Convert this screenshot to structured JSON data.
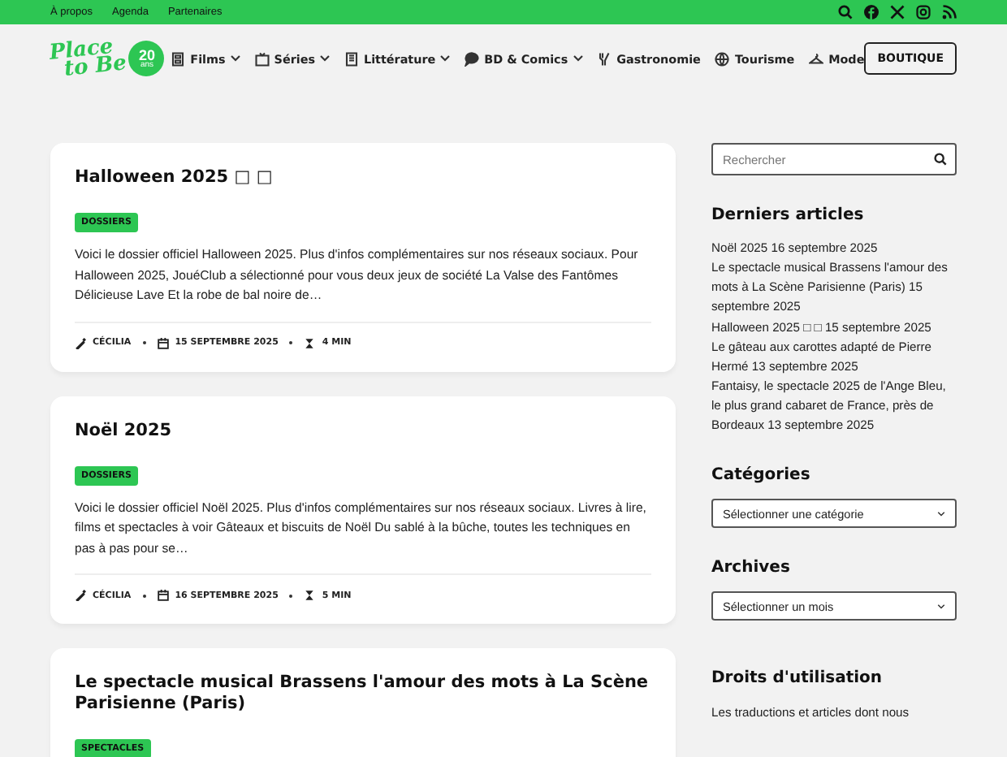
{
  "top_bar": {
    "links": [
      "À propos",
      "Agenda",
      "Partenaires"
    ]
  },
  "header": {
    "logo": {
      "line1": "Place",
      "line2": "to Be",
      "badge_number": "20",
      "badge_text": "ans"
    },
    "nav": [
      {
        "label": "Films",
        "kind": "film",
        "dropdown": true
      },
      {
        "label": "Séries",
        "kind": "tv",
        "dropdown": true
      },
      {
        "label": "Littérature",
        "kind": "book",
        "dropdown": true
      },
      {
        "label": "BD & Comics",
        "kind": "bubble",
        "dropdown": true
      },
      {
        "label": "Gastronomie",
        "kind": "cutlery",
        "dropdown": false
      },
      {
        "label": "Tourisme",
        "kind": "globe",
        "dropdown": false
      },
      {
        "label": "Mode",
        "kind": "hanger",
        "dropdown": false
      }
    ],
    "shop_button": "BOUTIQUE"
  },
  "posts": [
    {
      "title": "Halloween 2025 □ □",
      "category": "DOSSIERS",
      "excerpt": "Voici le dossier officiel Halloween 2025. Plus d'infos complémentaires sur nos réseaux sociaux. Pour Halloween 2025, JouéClub a sélectionné pour vous deux jeux de société La Valse des Fantômes Délicieuse Lave Et la robe de bal noire de…",
      "author": "CÉCILIA",
      "date": "15 SEPTEMBRE 2025",
      "read_time": "4 MIN"
    },
    {
      "title": "Noël 2025",
      "category": "DOSSIERS",
      "excerpt": "Voici le dossier officiel Noël 2025. Plus d'infos complémentaires sur nos réseaux sociaux. Livres à lire, films et spectacles à voir Gâteaux et biscuits de Noël Du sablé à la bûche, toutes les techniques en pas à pas pour se…",
      "author": "CÉCILIA",
      "date": "16 SEPTEMBRE 2025",
      "read_time": "5 MIN"
    },
    {
      "title": "Le spectacle musical Brassens l'amour des mots à La Scène Parisienne (Paris)",
      "category": "SPECTACLES"
    }
  ],
  "sidebar": {
    "search": {
      "placeholder": "Rechercher"
    },
    "recent": {
      "title": "Derniers articles",
      "items": [
        {
          "title": "Noël 2025",
          "date": "16 septembre 2025"
        },
        {
          "title": "Le spectacle musical Brassens l'amour des mots à La Scène Parisienne (Paris)",
          "date": "15 septembre 2025"
        },
        {
          "title": "Halloween 2025 □ □",
          "date": "15 septembre 2025"
        },
        {
          "title": "Le gâteau aux carottes adapté de Pierre Hermé",
          "date": "13 septembre 2025"
        },
        {
          "title": "Fantaisy, le spectacle 2025 de l'Ange Bleu, le plus grand cabaret de France, près de Bordeaux",
          "date": "13 septembre 2025"
        }
      ]
    },
    "categories": {
      "title": "Catégories",
      "select": "Sélectionner une catégorie"
    },
    "archives": {
      "title": "Archives",
      "select": "Sélectionner un mois"
    },
    "rights": {
      "title": "Droits d'utilisation",
      "text": "Les traductions et articles dont nous"
    }
  }
}
